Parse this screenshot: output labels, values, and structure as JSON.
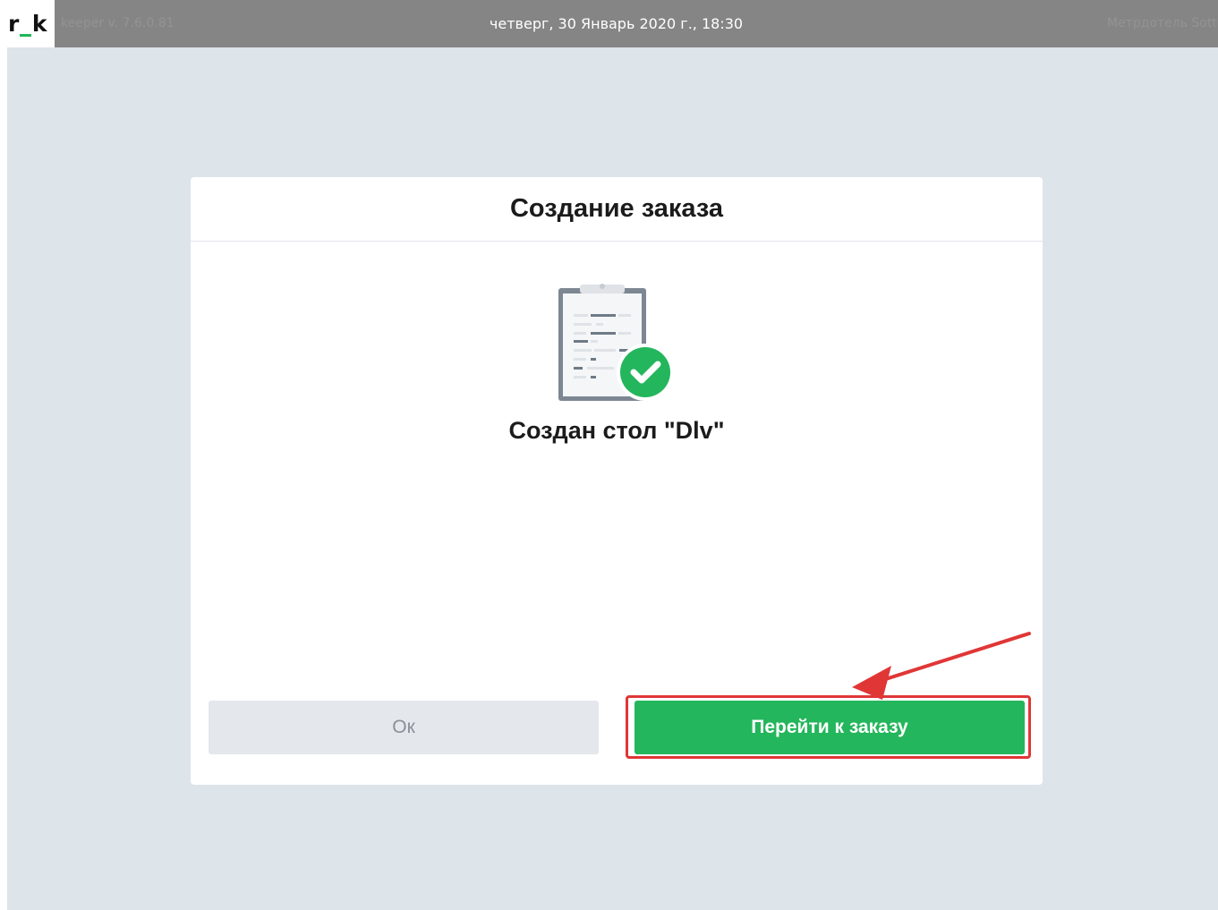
{
  "topbar": {
    "logo_left": "r",
    "logo_right": "k",
    "version": "keeper v. 7.6.0.81",
    "datetime": "четверг, 30 Январь 2020 г., 18:30",
    "role": "Метрдотель Sotto"
  },
  "dialog": {
    "title": "Создание заказа",
    "message": "Создан стол \"Dlv\"",
    "icon": "clipboard-check-icon",
    "ok_label": "Ок",
    "goto_label": "Перейти к заказу"
  },
  "colors": {
    "accent_green": "#24b65c",
    "highlight_red": "#e03636",
    "workspace_bg": "#dde4ea",
    "topbar_bg": "#858585"
  }
}
